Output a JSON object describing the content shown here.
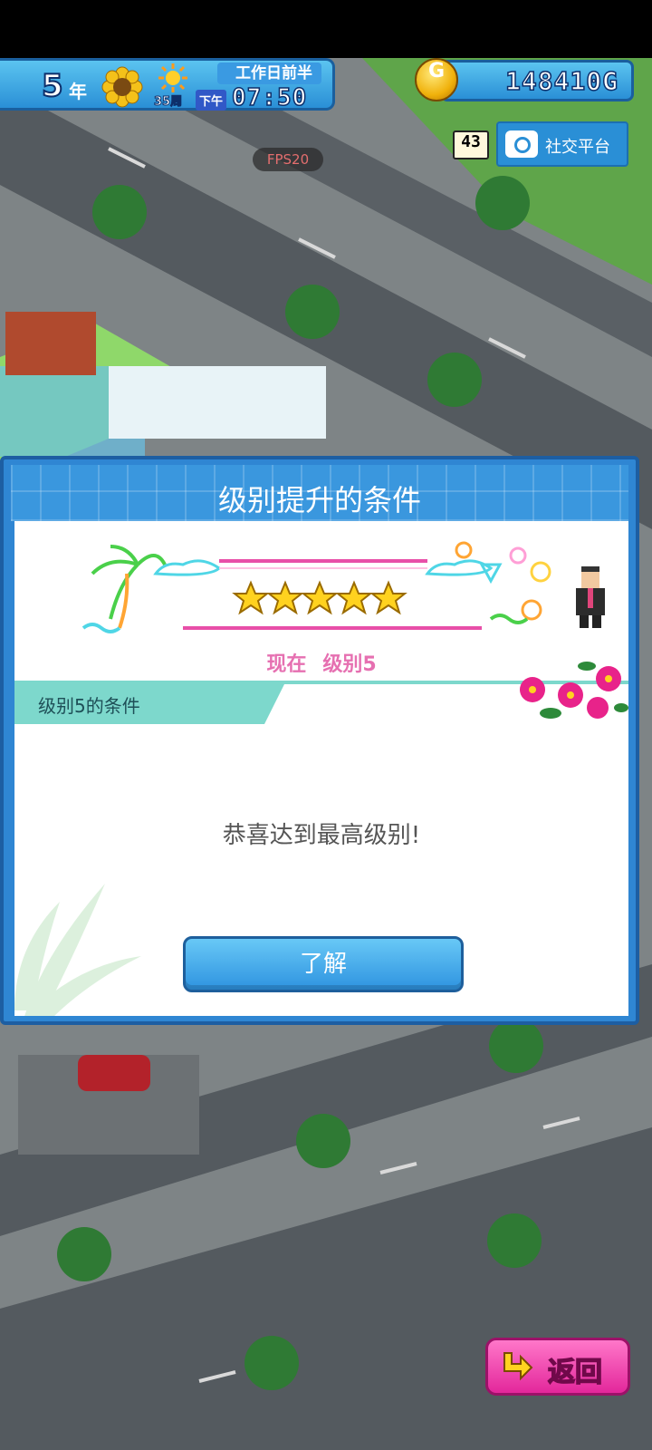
{
  "hud": {
    "year_number": "5",
    "year_unit": "年",
    "week": "35周",
    "ampm": "下午",
    "period": "工作日前半",
    "time": "07:50",
    "money": "148410G",
    "coin_symbol": "G"
  },
  "top_right": {
    "level_chip": "43",
    "social_label": "社交平台"
  },
  "fps_label": "FPS20",
  "dialog": {
    "title": "级别提升的条件",
    "current_label": "现在",
    "current_level": "级别5",
    "condition_tab": "级别5的条件",
    "message": "恭喜达到最高级别!",
    "ok_label": "了解",
    "stars": 5
  },
  "back_label": "返回",
  "colors": {
    "hud_blue": "#2a8fd6",
    "dialog_blue": "#2f86d3",
    "tab_teal": "#7dd8cc",
    "level_pink": "#e670b1",
    "back_pink": "#e3279b"
  }
}
